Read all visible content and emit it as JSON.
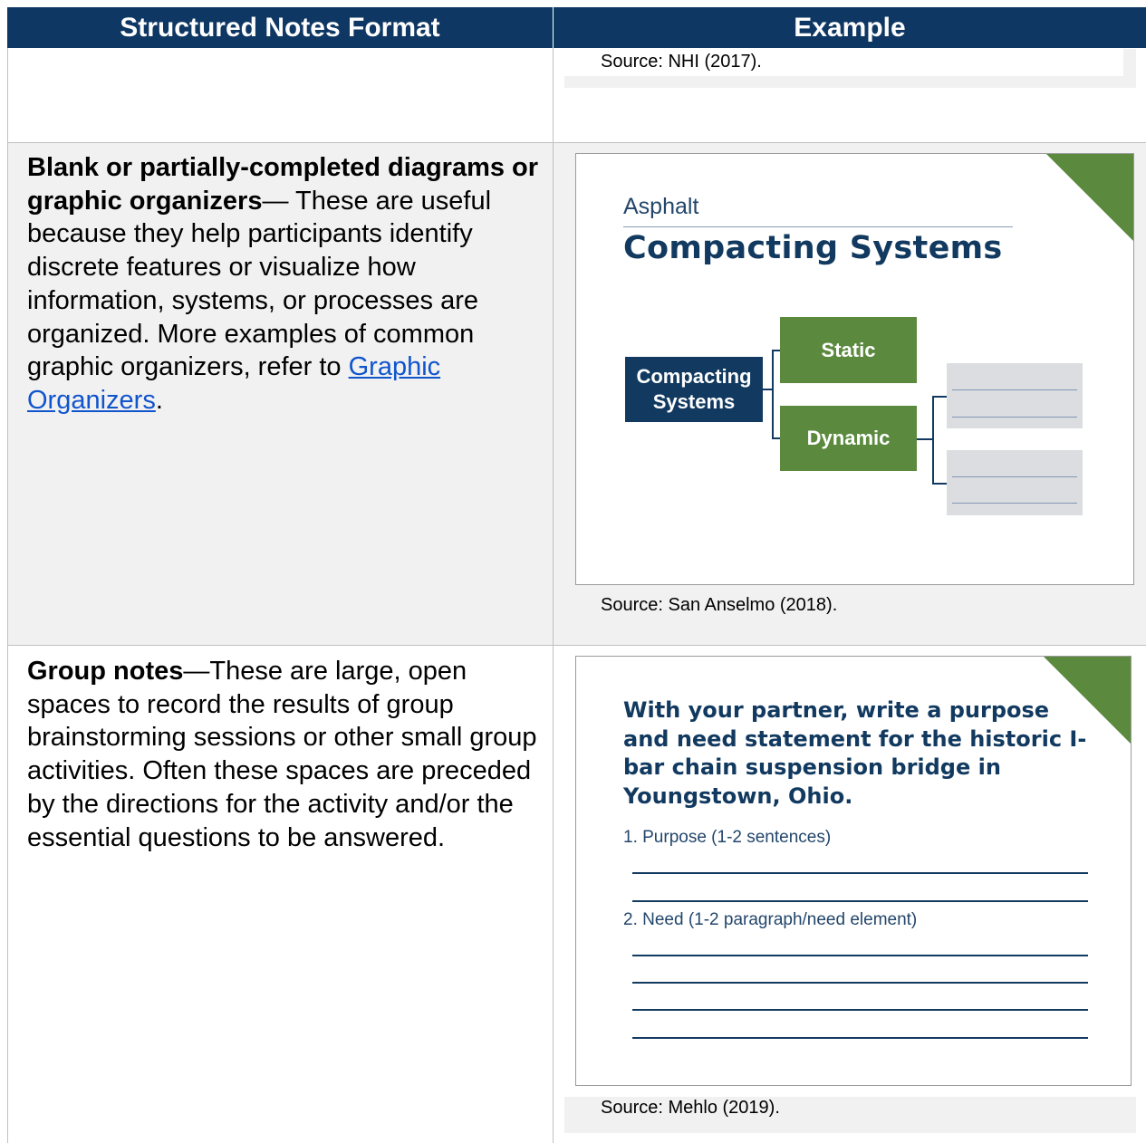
{
  "header": {
    "col1_title": "Structured Notes Format",
    "col2_title": "Example"
  },
  "colors": {
    "header_bg": "#0e3763",
    "navy": "#123a60",
    "green": "#5b8a3f",
    "link": "#1155cc",
    "cell_shade": "#f1f1f1"
  },
  "rows": [
    {
      "source": "Source: NHI (2017)."
    },
    {
      "title": "Blank or partially-completed diagrams or graphic organizers",
      "dash": "—",
      "body": "These are useful because they help participants identify discrete features or visualize how information, systems, or processes are organized. More examples of common graphic organizers, refer to ",
      "link_text": "Graphic Organizers",
      "after_link": ".",
      "slide": {
        "subtitle": "Asphalt",
        "title": "Compacting Systems",
        "root_node": "Compacting Systems",
        "child_nodes": [
          "Static",
          "Dynamic"
        ]
      },
      "source": "Source: San Anselmo (2018)."
    },
    {
      "title": "Group notes",
      "body": "—These are large, open spaces to record the results of group brainstorming sessions or other small group activities. Often these spaces are preceded by the directions for the activity and/or the essential questions to be answered.",
      "slide": {
        "prompt": "With your partner, write a purpose and need statement for the historic I-bar chain suspension bridge in Youngstown, Ohio.",
        "q1": "1. Purpose (1-2 sentences)",
        "q2": "2. Need (1-2 paragraph/need element)"
      },
      "source": "Source: Mehlo (2019)."
    }
  ]
}
